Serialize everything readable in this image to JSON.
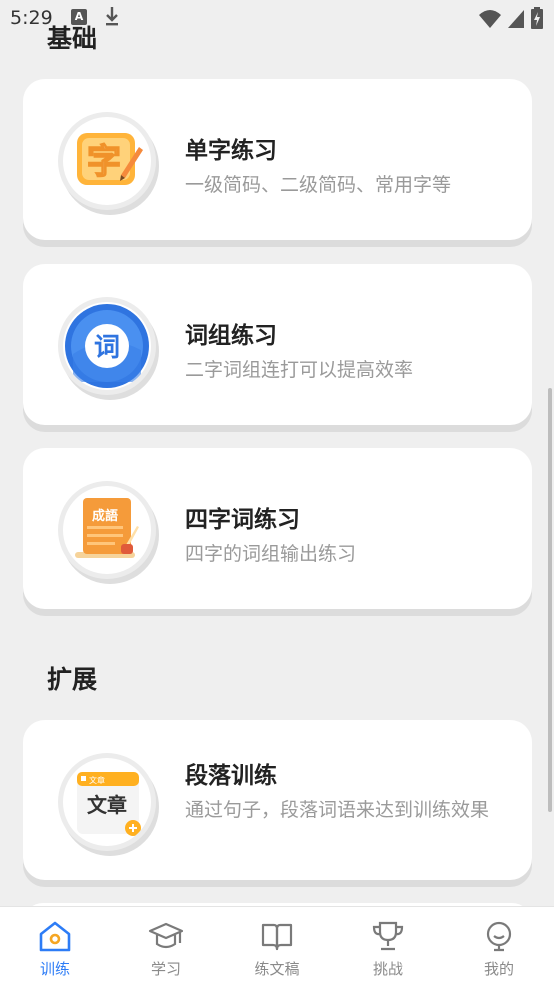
{
  "status_bar": {
    "time": "5:29",
    "notification_icons": [
      "text-a-icon",
      "download-icon"
    ],
    "system_icons": [
      "wifi-icon",
      "signal-icon",
      "battery-charging-icon"
    ]
  },
  "sections": [
    {
      "title": "基础",
      "cards": [
        {
          "title": "单字练习",
          "description": "一级简码、二级简码、常用字等",
          "icon": "character-icon",
          "icon_text": "字"
        },
        {
          "title": "词组练习",
          "description": "二字词组连打可以提高效率",
          "icon": "word-icon",
          "icon_text": "词"
        },
        {
          "title": "四字词练习",
          "description": "四字的词组输出练习",
          "icon": "idiom-book-icon",
          "icon_text": "成語"
        }
      ]
    },
    {
      "title": "扩展",
      "cards": [
        {
          "title": "段落训练",
          "description": "通过句子，段落词语来达到训练效果",
          "icon": "article-icon",
          "icon_text": "文章",
          "icon_tag": "文章"
        }
      ]
    }
  ],
  "bottom_nav": {
    "active": "训练",
    "accent_color": "#2d7cf6",
    "items": [
      {
        "label": "训练",
        "icon": "home-icon"
      },
      {
        "label": "学习",
        "icon": "graduation-cap-icon"
      },
      {
        "label": "练文稿",
        "icon": "open-book-icon"
      },
      {
        "label": "挑战",
        "icon": "trophy-icon"
      },
      {
        "label": "我的",
        "icon": "profile-icon"
      }
    ]
  }
}
